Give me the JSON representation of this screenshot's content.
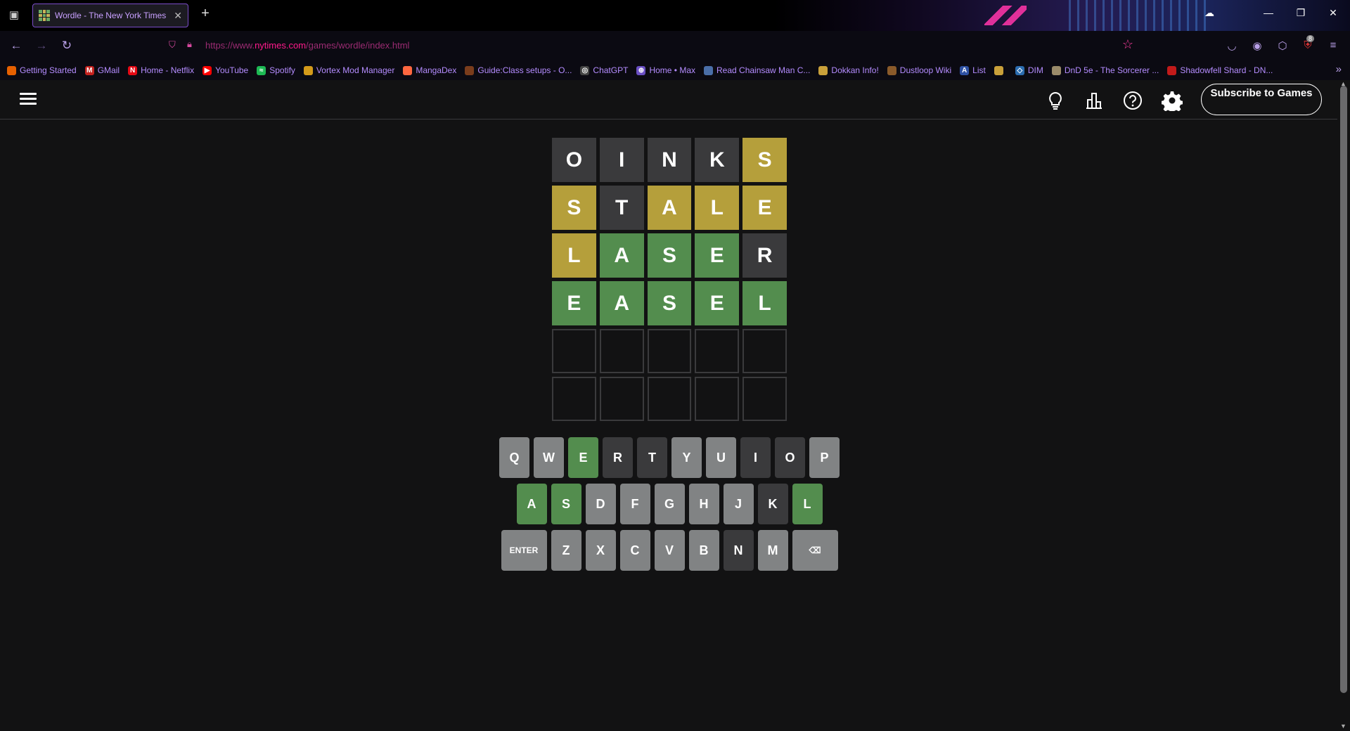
{
  "browser": {
    "tab_title": "Wordle - The New York Times",
    "url_prefix": "https://www.",
    "url_domain": "nytimes.com",
    "url_path": "/games/wordle/index.html",
    "bookmarks": [
      {
        "label": "Getting Started",
        "icon_color": "#e66000",
        "glyph": ""
      },
      {
        "label": "GMail",
        "icon_color": "#c5221f",
        "glyph": "M"
      },
      {
        "label": "Home - Netflix",
        "icon_color": "#e50914",
        "glyph": "N"
      },
      {
        "label": "YouTube",
        "icon_color": "#ff0000",
        "glyph": "▶"
      },
      {
        "label": "Spotify",
        "icon_color": "#1db954",
        "glyph": "≈"
      },
      {
        "label": "Vortex Mod Manager",
        "icon_color": "#d49a1a",
        "glyph": ""
      },
      {
        "label": "MangaDex",
        "icon_color": "#ff6740",
        "glyph": ""
      },
      {
        "label": "Guide:Class setups - O...",
        "icon_color": "#7a3c1c",
        "glyph": ""
      },
      {
        "label": "ChatGPT",
        "icon_color": "#444444",
        "glyph": "◎"
      },
      {
        "label": "Home • Max",
        "icon_color": "#6a4fc4",
        "glyph": "⊕"
      },
      {
        "label": "Read Chainsaw Man C...",
        "icon_color": "#4a6ea8",
        "glyph": ""
      },
      {
        "label": "Dokkan Info!",
        "icon_color": "#c9a03a",
        "glyph": ""
      },
      {
        "label": "Dustloop Wiki",
        "icon_color": "#8a5a2a",
        "glyph": ""
      },
      {
        "label": "List",
        "icon_color": "#2e51a2",
        "glyph": "A"
      },
      {
        "label": "",
        "icon_color": "#c9a03a",
        "glyph": ""
      },
      {
        "label": "DIM",
        "icon_color": "#2b6cb0",
        "glyph": "◇"
      },
      {
        "label": "DnD 5e - The Sorcerer ...",
        "icon_color": "#9a8a6a",
        "glyph": ""
      },
      {
        "label": "Shadowfell Shard - DN...",
        "icon_color": "#c21a1a",
        "glyph": ""
      }
    ],
    "extension_badge": "8"
  },
  "header": {
    "subscribe_label": "Subscribe to Games"
  },
  "board": {
    "rows": [
      [
        {
          "letter": "O",
          "state": "absent"
        },
        {
          "letter": "I",
          "state": "absent"
        },
        {
          "letter": "N",
          "state": "absent"
        },
        {
          "letter": "K",
          "state": "absent"
        },
        {
          "letter": "S",
          "state": "present"
        }
      ],
      [
        {
          "letter": "S",
          "state": "present"
        },
        {
          "letter": "T",
          "state": "absent"
        },
        {
          "letter": "A",
          "state": "present"
        },
        {
          "letter": "L",
          "state": "present"
        },
        {
          "letter": "E",
          "state": "present"
        }
      ],
      [
        {
          "letter": "L",
          "state": "present"
        },
        {
          "letter": "A",
          "state": "correct"
        },
        {
          "letter": "S",
          "state": "correct"
        },
        {
          "letter": "E",
          "state": "correct"
        },
        {
          "letter": "R",
          "state": "absent"
        }
      ],
      [
        {
          "letter": "E",
          "state": "correct"
        },
        {
          "letter": "A",
          "state": "correct"
        },
        {
          "letter": "S",
          "state": "correct"
        },
        {
          "letter": "E",
          "state": "correct"
        },
        {
          "letter": "L",
          "state": "correct"
        }
      ],
      [
        {
          "letter": "",
          "state": "empty"
        },
        {
          "letter": "",
          "state": "empty"
        },
        {
          "letter": "",
          "state": "empty"
        },
        {
          "letter": "",
          "state": "empty"
        },
        {
          "letter": "",
          "state": "empty"
        }
      ],
      [
        {
          "letter": "",
          "state": "empty"
        },
        {
          "letter": "",
          "state": "empty"
        },
        {
          "letter": "",
          "state": "empty"
        },
        {
          "letter": "",
          "state": "empty"
        },
        {
          "letter": "",
          "state": "empty"
        }
      ]
    ]
  },
  "keyboard": {
    "rows": [
      [
        {
          "k": "Q",
          "s": "unused"
        },
        {
          "k": "W",
          "s": "unused"
        },
        {
          "k": "E",
          "s": "correct"
        },
        {
          "k": "R",
          "s": "absent"
        },
        {
          "k": "T",
          "s": "absent"
        },
        {
          "k": "Y",
          "s": "unused"
        },
        {
          "k": "U",
          "s": "unused"
        },
        {
          "k": "I",
          "s": "absent"
        },
        {
          "k": "O",
          "s": "absent"
        },
        {
          "k": "P",
          "s": "unused"
        }
      ],
      [
        {
          "k": "A",
          "s": "correct"
        },
        {
          "k": "S",
          "s": "correct"
        },
        {
          "k": "D",
          "s": "unused"
        },
        {
          "k": "F",
          "s": "unused"
        },
        {
          "k": "G",
          "s": "unused"
        },
        {
          "k": "H",
          "s": "unused"
        },
        {
          "k": "J",
          "s": "unused"
        },
        {
          "k": "K",
          "s": "absent"
        },
        {
          "k": "L",
          "s": "correct"
        }
      ],
      [
        {
          "k": "ENTER",
          "s": "unused",
          "wide": true
        },
        {
          "k": "Z",
          "s": "unused"
        },
        {
          "k": "X",
          "s": "unused"
        },
        {
          "k": "C",
          "s": "unused"
        },
        {
          "k": "V",
          "s": "unused"
        },
        {
          "k": "B",
          "s": "unused"
        },
        {
          "k": "N",
          "s": "absent"
        },
        {
          "k": "M",
          "s": "unused"
        },
        {
          "k": "⌫",
          "s": "unused",
          "wide": true,
          "name": "backspace-key"
        }
      ]
    ]
  },
  "colors": {
    "correct": "#538d4e",
    "present": "#b59f3b",
    "absent": "#3a3a3c",
    "unused_key": "#818384",
    "background": "#121213"
  }
}
